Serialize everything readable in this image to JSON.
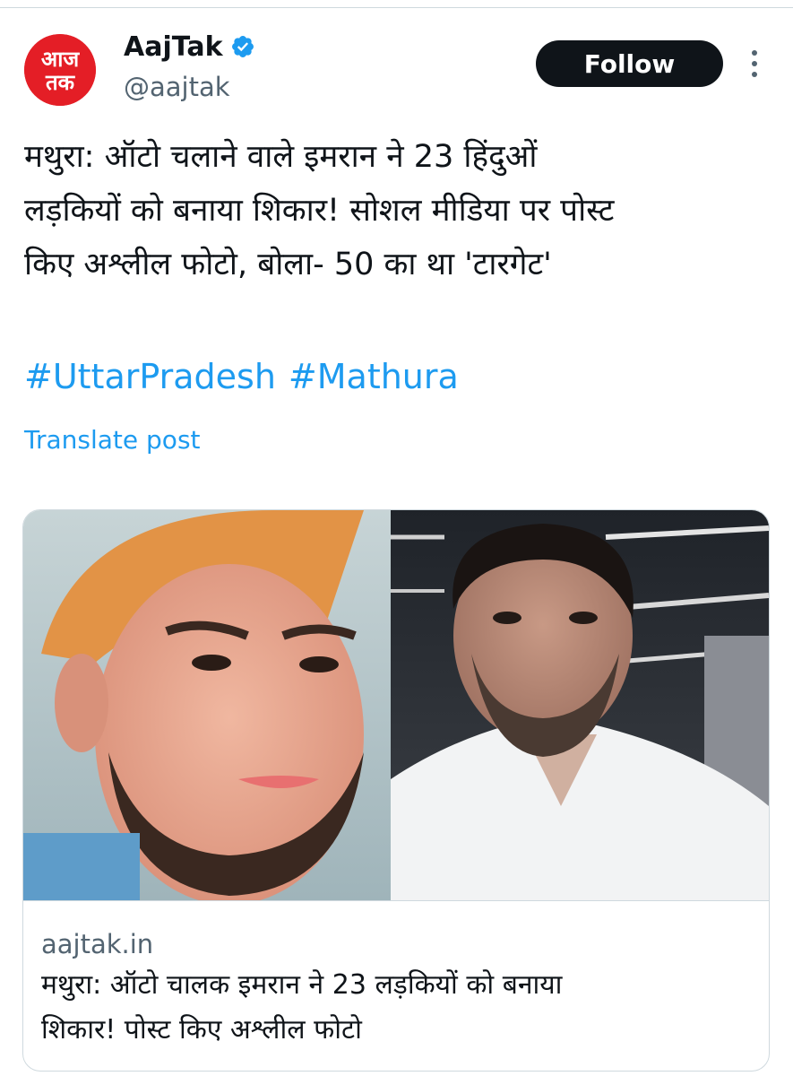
{
  "account": {
    "display_name": "AajTak",
    "handle": "@aajtak",
    "logo_text_top": "आज",
    "logo_text_bottom": "तक",
    "verified_icon": "verified-badge-icon",
    "brand_color": "#e41e26"
  },
  "follow_label": "Follow",
  "more_icon": "more-vertical-icon",
  "post": {
    "lines": [
      "मथुरा: ऑटो चलाने वाले इमरान ने 23 हिंदुओं",
      "लड़कियों को बनाया शिकार! सोशल मीडिया पर पोस्ट",
      "किए अश्लील फोटो, बोला- 50 का था 'टारगेट'"
    ],
    "hashtags": [
      "#UttarPradesh",
      "#Mathura"
    ],
    "translate_label": "Translate post"
  },
  "card": {
    "domain": "aajtak.in",
    "title_lines": [
      "मथुरा: ऑटो चालक इमरान ने 23 लड़कियों को बनाया",
      "शिकार! पोस्ट किए अश्लील फोटो"
    ]
  },
  "colors": {
    "link": "#1d9bf0",
    "text": "#0f1419",
    "secondary": "#536471",
    "border": "#cfd9de",
    "button_bg": "#0f1419"
  }
}
